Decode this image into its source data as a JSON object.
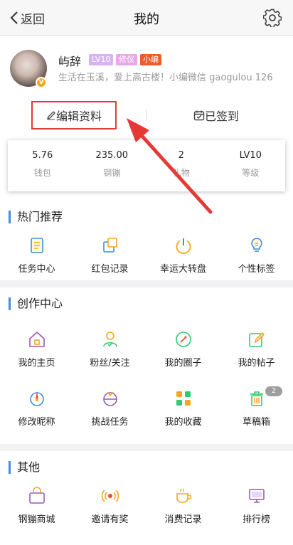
{
  "header": {
    "back_label": "返回",
    "title": "我的"
  },
  "profile": {
    "name": "屿辞",
    "tags": [
      "LV10",
      "修仪",
      "小编"
    ],
    "bio": "生活在玉溪，爱上高古楼！小编微信 gaogulou 126",
    "edit_label": "编辑资料",
    "signed_label": "已签到"
  },
  "stats": [
    {
      "value": "5.76",
      "label": "钱包"
    },
    {
      "value": "235.00",
      "label": "钢镚"
    },
    {
      "value": "2",
      "label": "礼物"
    },
    {
      "value": "LV10",
      "label": "等级"
    }
  ],
  "hot": {
    "title": "热门推荐",
    "items": [
      {
        "label": "任务中心",
        "icon": "task-icon"
      },
      {
        "label": "红包记录",
        "icon": "red-packet-icon"
      },
      {
        "label": "幸运大转盘",
        "icon": "power-wheel-icon"
      },
      {
        "label": "个性标签",
        "icon": "bulb-tag-icon"
      }
    ]
  },
  "create": {
    "title": "创作中心",
    "items": [
      {
        "label": "我的主页",
        "icon": "home-icon"
      },
      {
        "label": "粉丝/关注",
        "icon": "fans-icon"
      },
      {
        "label": "我的圈子",
        "icon": "circle-icon"
      },
      {
        "label": "我的帖子",
        "icon": "post-edit-icon"
      },
      {
        "label": "修改昵称",
        "icon": "nickname-icon"
      },
      {
        "label": "挑战任务",
        "icon": "challenge-icon"
      },
      {
        "label": "我的收藏",
        "icon": "collection-icon"
      },
      {
        "label": "草稿箱",
        "icon": "draft-trash-icon",
        "badge": "2"
      }
    ]
  },
  "other": {
    "title": "其他",
    "items": [
      {
        "label": "钢镚商城",
        "icon": "shop-bag-icon"
      },
      {
        "label": "邀请有奖",
        "icon": "invite-broadcast-icon"
      },
      {
        "label": "消费记录",
        "icon": "coffee-icon"
      },
      {
        "label": "排行榜",
        "icon": "monitor-rank-icon"
      }
    ]
  },
  "colors": {
    "accent": "#3c8ee6",
    "highlight_box": "#e53935",
    "orange": "#f5a623"
  }
}
